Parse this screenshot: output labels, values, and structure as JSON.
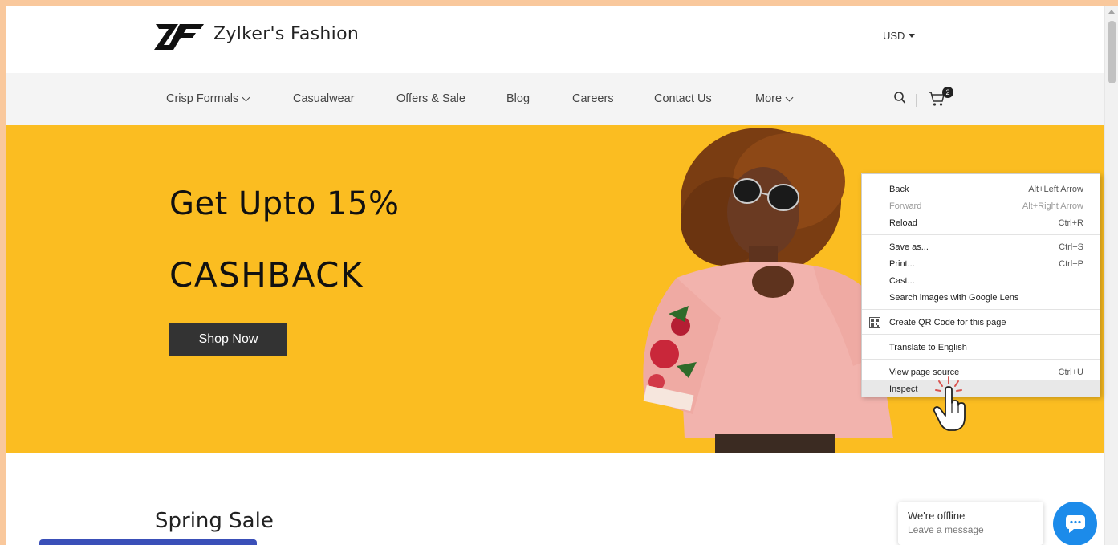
{
  "header": {
    "brand": "Zylker's Fashion",
    "currency": "USD"
  },
  "nav": {
    "items": [
      {
        "label": "Crisp Formals",
        "has_dropdown": true
      },
      {
        "label": "Casualwear",
        "has_dropdown": false
      },
      {
        "label": "Offers & Sale",
        "has_dropdown": false
      },
      {
        "label": "Blog",
        "has_dropdown": false
      },
      {
        "label": "Careers",
        "has_dropdown": false
      },
      {
        "label": "Contact Us",
        "has_dropdown": false
      },
      {
        "label": "More",
        "has_dropdown": true
      }
    ],
    "cart_count": "2",
    "icons": [
      "search-icon",
      "cart-icon"
    ]
  },
  "hero": {
    "headline": "Get Upto 15%",
    "subheadline": "CASHBACK",
    "cta": "Shop Now",
    "bg_color": "#fbbd21"
  },
  "section": {
    "title": "Spring Sale"
  },
  "chat": {
    "status": "We're offline",
    "prompt": "Leave a message",
    "button_color": "#1c8bea"
  },
  "context_menu": {
    "items": [
      {
        "label": "Back",
        "shortcut": "Alt+Left Arrow",
        "disabled": false
      },
      {
        "label": "Forward",
        "shortcut": "Alt+Right Arrow",
        "disabled": true
      },
      {
        "label": "Reload",
        "shortcut": "Ctrl+R",
        "disabled": false
      },
      {
        "label": "Save as...",
        "shortcut": "Ctrl+S",
        "disabled": false
      },
      {
        "label": "Print...",
        "shortcut": "Ctrl+P",
        "disabled": false
      },
      {
        "label": "Cast...",
        "shortcut": "",
        "disabled": false
      },
      {
        "label": "Search images with Google Lens",
        "shortcut": "",
        "disabled": false
      },
      {
        "label": "Create QR Code for this page",
        "shortcut": "",
        "disabled": false,
        "icon": "qr-code-icon"
      },
      {
        "label": "Translate to English",
        "shortcut": "",
        "disabled": false
      },
      {
        "label": "View page source",
        "shortcut": "Ctrl+U",
        "disabled": false
      },
      {
        "label": "Inspect",
        "shortcut": "",
        "disabled": false,
        "hovered": true
      }
    ]
  }
}
